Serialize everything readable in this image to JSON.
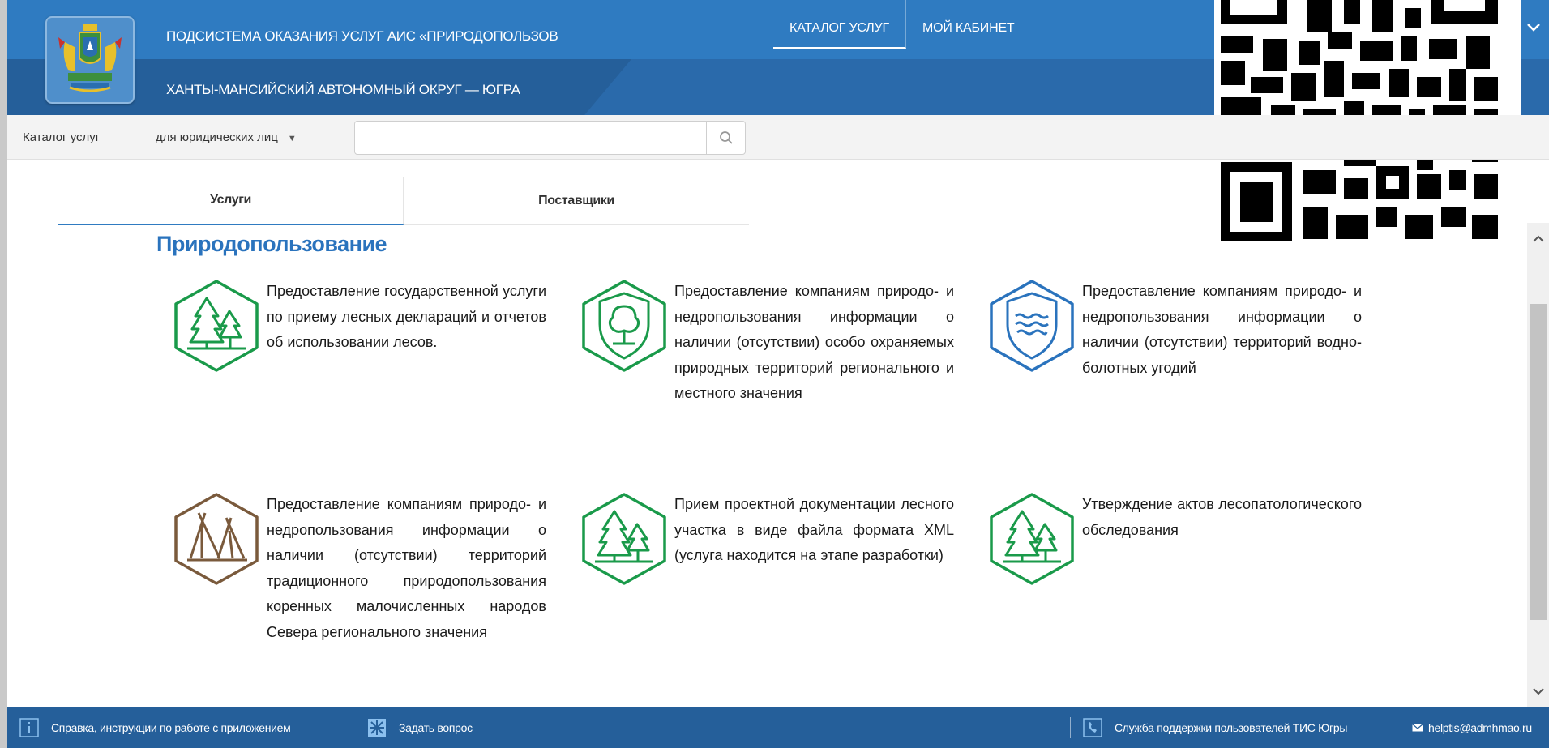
{
  "header": {
    "title": "ПОДСИСТЕМА ОКАЗАНИЯ УСЛУГ АИС «ПРИРОДОПОЛЬЗОВ",
    "subtitle": "ХАНТЫ-МАНСИЙСКИЙ АВТОНОМНЫЙ ОКРУГ — ЮГРА",
    "nav": [
      {
        "label": "КАТАЛОГ УСЛУГ",
        "active": true
      },
      {
        "label": "МОЙ КАБИНЕТ",
        "active": false
      }
    ],
    "menu_caret": "❯"
  },
  "catalog_bar": {
    "label": "Каталог услуг",
    "audience_select": "для юридических лиц",
    "search_value": ""
  },
  "tabs": [
    {
      "label": "Услуги",
      "active": true
    },
    {
      "label": "Поставщики",
      "active": false
    }
  ],
  "section": {
    "title": "Природопользование",
    "services": [
      {
        "icon": "forest-icon",
        "color": "#1a9a4a",
        "text": "Предоставление государственной услуги по приему лесных деклараций и отчетов об использовании лесов."
      },
      {
        "icon": "protected-area-shield-icon",
        "color": "#1a9a4a",
        "text": "Предоставление компаниям природо- и недропользования информации о наличии (отсутствии) особо охраняемых природных территорий регионального и местного значения"
      },
      {
        "icon": "wetland-shield-icon",
        "color": "#2a73bd",
        "text": "Предоставление компаниям природо- и недропользования информации о наличии (отсутствии) территорий водно-болотных угодий"
      },
      {
        "icon": "tent-icon",
        "color": "#7a5a3c",
        "text": "Предоставление компаниям природо- и недропользования информации о наличии (отсутствии) территорий традиционного природопользования коренных малочисленных народов Севера регионального значения"
      },
      {
        "icon": "forest-icon",
        "color": "#1a9a4a",
        "text": "Прием проектной документации лесного участка в виде файла формата XML (услуга находится на этапе разработки)"
      },
      {
        "icon": "forest-icon",
        "color": "#1a9a4a",
        "text": "Утверждение актов лесопатологического обследования"
      }
    ]
  },
  "footer": {
    "help_label": "Справка, инструкции по работе с приложением",
    "ask_label": "Задать вопрос",
    "support_label": "Служба поддержки пользователей ТИС Югры",
    "email": "helptis@admhmao.ru"
  }
}
